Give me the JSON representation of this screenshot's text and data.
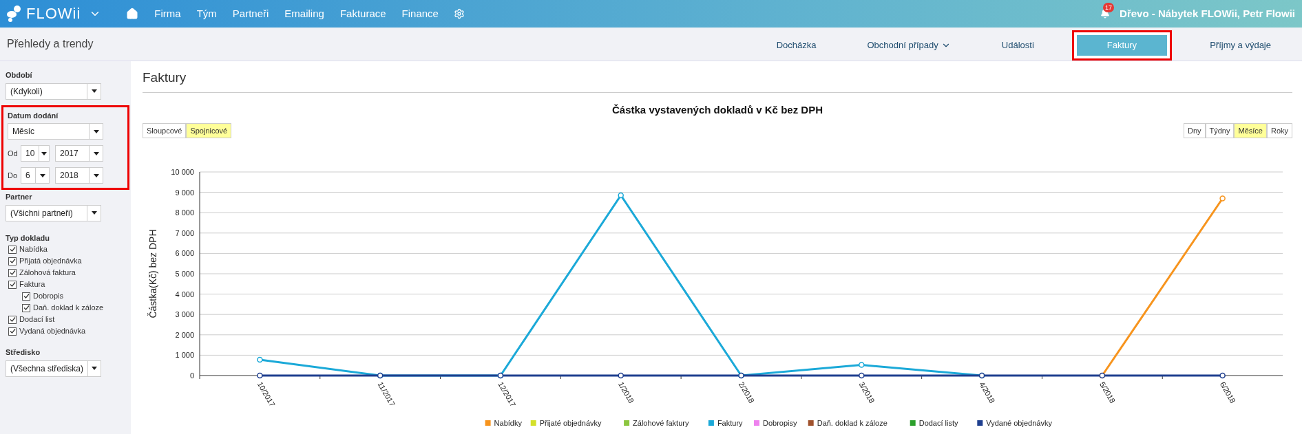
{
  "topbar": {
    "logo": "FLOWii",
    "nav": [
      "Firma",
      "Tým",
      "Partneři",
      "Emailing",
      "Fakturace",
      "Finance"
    ],
    "notifications": "17",
    "user": "Dřevo - Nábytek FLOWii, Petr Flowii"
  },
  "subheader": {
    "title": "Přehledy a trendy",
    "tabs": [
      {
        "label": "Docházka",
        "kind": "link",
        "selected": false,
        "highlighted": false
      },
      {
        "label": "Obchodní případy",
        "kind": "dropdown",
        "selected": false,
        "highlighted": false
      },
      {
        "label": "Události",
        "kind": "link",
        "selected": false,
        "highlighted": false
      },
      {
        "label": "Faktury",
        "kind": "link",
        "selected": true,
        "highlighted": true
      },
      {
        "label": "Příjmy a výdaje",
        "kind": "link",
        "selected": false,
        "highlighted": false
      }
    ]
  },
  "sidebar": {
    "period": {
      "label": "Období",
      "value": "(Kdykoli)"
    },
    "delivery": {
      "label": "Datum dodání",
      "value": "Měsíc",
      "highlighted": true,
      "from": {
        "label": "Od",
        "month": "10",
        "year": "2017"
      },
      "to": {
        "label": "Do",
        "month": "6",
        "year": "2018"
      }
    },
    "partner": {
      "label": "Partner",
      "value": "(Všichni partneři)"
    },
    "doc_types": {
      "label": "Typ dokladu",
      "items": [
        {
          "label": "Nabídka",
          "checked": true
        },
        {
          "label": "Přijatá objednávka",
          "checked": true
        },
        {
          "label": "Zálohová faktura",
          "checked": true
        },
        {
          "label": "Faktura",
          "checked": true,
          "children": [
            {
              "label": "Dobropis",
              "checked": true
            },
            {
              "label": "Daň. doklad k záloze",
              "checked": true
            }
          ]
        },
        {
          "label": "Dodací list",
          "checked": true
        },
        {
          "label": "Vydaná objednávka",
          "checked": true
        }
      ]
    },
    "center": {
      "label": "Středisko",
      "value": "(Všechna střediska)"
    }
  },
  "main": {
    "title": "Faktury",
    "chart_types": [
      {
        "label": "Sloupcové",
        "selected": false
      },
      {
        "label": "Spojnicové",
        "selected": true
      }
    ],
    "granularity": [
      {
        "label": "Dny",
        "selected": false
      },
      {
        "label": "Týdny",
        "selected": false
      },
      {
        "label": "Měsíce",
        "selected": true
      },
      {
        "label": "Roky",
        "selected": false
      }
    ],
    "chart_data": {
      "type": "line",
      "title": "Částka vystavených dokladů v Kč bez DPH",
      "ylabel": "Částka(Kč) bez DPH",
      "categories": [
        "10/2017",
        "11/2017",
        "12/2017",
        "1/2018",
        "2/2018",
        "3/2018",
        "4/2018",
        "5/2018",
        "6/2018"
      ],
      "ylim": [
        0,
        10000
      ],
      "grid": true,
      "legend": "bottom",
      "yticks": [
        {
          "value": 0,
          "label": "0"
        },
        {
          "value": 1000,
          "label": "1 000"
        },
        {
          "value": 2000,
          "label": "2 000"
        },
        {
          "value": 3000,
          "label": "3 000"
        },
        {
          "value": 4000,
          "label": "4 000"
        },
        {
          "value": 5000,
          "label": "5 000"
        },
        {
          "value": 6000,
          "label": "6 000"
        },
        {
          "value": 7000,
          "label": "7 000"
        },
        {
          "value": 8000,
          "label": "8 000"
        },
        {
          "value": 9000,
          "label": "9 000"
        },
        {
          "value": 10000,
          "label": "10 000"
        }
      ],
      "series": [
        {
          "name": "Nabídky",
          "color": "#f7941d",
          "marker": "circle",
          "values": [
            null,
            null,
            null,
            null,
            null,
            null,
            null,
            0,
            8700
          ]
        },
        {
          "name": "Přijaté objednávky",
          "color": "#d4e02a",
          "marker": "circle",
          "values": [
            null,
            null,
            null,
            null,
            null,
            null,
            null,
            null,
            null
          ]
        },
        {
          "name": "Zálohové faktury",
          "color": "#8cc63f",
          "marker": "circle",
          "values": [
            null,
            null,
            null,
            null,
            null,
            null,
            null,
            null,
            null
          ]
        },
        {
          "name": "Faktury",
          "color": "#1ba9d8",
          "marker": "circle",
          "values": [
            780,
            0,
            0,
            8850,
            0,
            520,
            0,
            null,
            null
          ]
        },
        {
          "name": "Dobropisy",
          "color": "#ee82ee",
          "marker": "circle",
          "values": [
            null,
            null,
            null,
            null,
            null,
            null,
            null,
            null,
            null
          ]
        },
        {
          "name": "Daň. doklad k záloze",
          "color": "#a0522d",
          "marker": "circle",
          "values": [
            null,
            null,
            null,
            null,
            null,
            null,
            null,
            null,
            null
          ]
        },
        {
          "name": "Dodací listy",
          "color": "#2ca02c",
          "marker": "circle",
          "values": [
            null,
            null,
            null,
            null,
            null,
            null,
            null,
            null,
            null
          ]
        },
        {
          "name": "Vydané objednávky",
          "color": "#1f3f8f",
          "marker": "circle",
          "values": [
            0,
            0,
            0,
            0,
            0,
            0,
            0,
            0,
            0
          ]
        }
      ]
    }
  }
}
